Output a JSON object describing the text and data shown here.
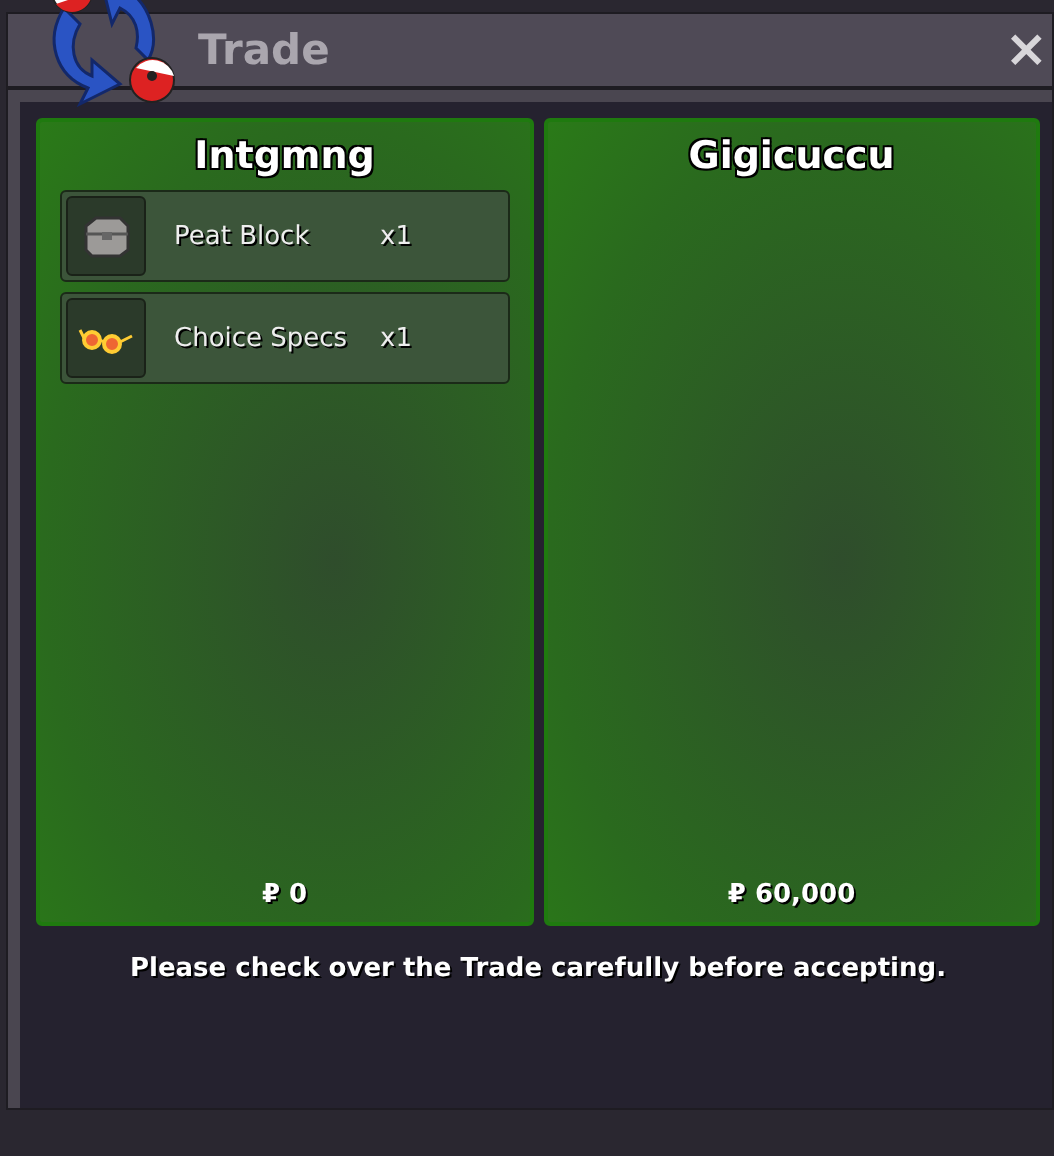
{
  "window": {
    "title": "Trade",
    "close": "×"
  },
  "parties": [
    {
      "name": "Intgmng",
      "items": [
        {
          "kind": "block",
          "name": "Peat Block",
          "quantity": "x1"
        },
        {
          "kind": "glasses",
          "name": "Choice Specs",
          "quantity": "x1"
        }
      ],
      "money": "₽ 0"
    },
    {
      "name": "Gigicuccu",
      "money": "₽ 60,000"
    }
  ],
  "message": "Please check over the Trade carefully before accepting."
}
